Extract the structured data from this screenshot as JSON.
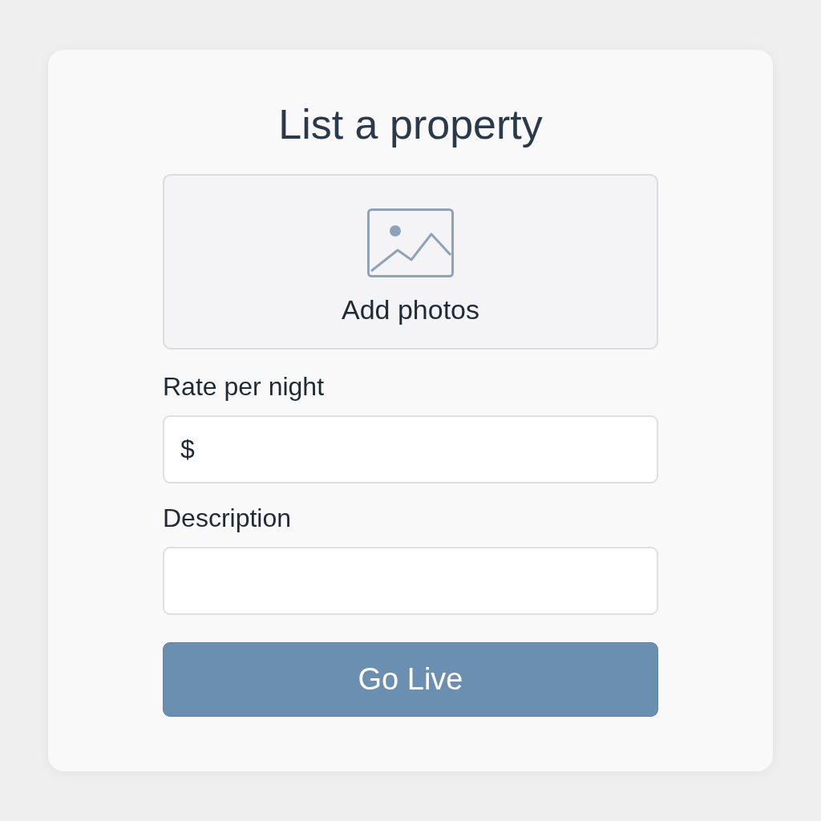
{
  "title": "List a property",
  "upload": {
    "label": "Add photos"
  },
  "fields": [
    {
      "label": "Rate per night",
      "prefix": "$"
    },
    {
      "label": "Description"
    }
  ],
  "button": {
    "label": "Go Live"
  }
}
